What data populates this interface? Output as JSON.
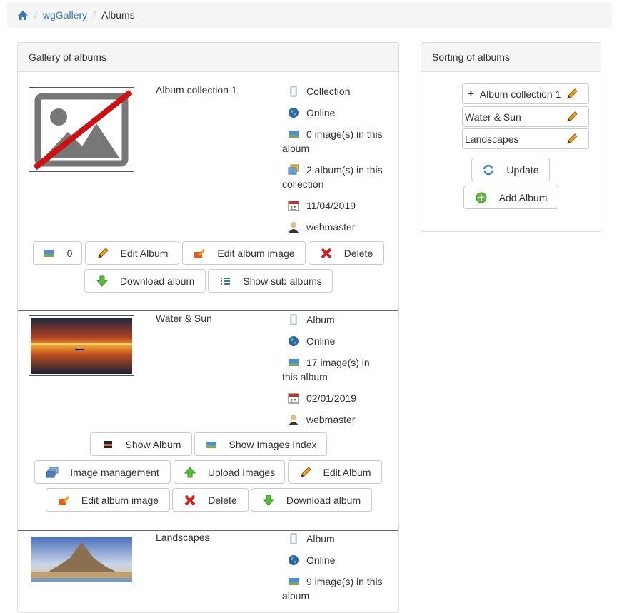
{
  "breadcrumb": {
    "items": [
      "wgGallery",
      "Albums"
    ]
  },
  "gallery_panel": {
    "heading": "Gallery of albums",
    "albums": [
      {
        "name": "Album collection 1",
        "type": "Collection",
        "status": "Online",
        "images_line1": "0 image(s) in this",
        "images_line2": "album",
        "collection_line1": "2 album(s) in this",
        "collection_line2": "collection",
        "date": "11/04/2019",
        "author": "webmaster",
        "buttons": {
          "count": "0",
          "edit_album": "Edit Album",
          "edit_album_image": "Edit album image",
          "delete": "Delete",
          "download_album": "Download album",
          "show_sub_albums": "Show sub albums"
        }
      },
      {
        "name": "Water & Sun",
        "type": "Album",
        "status": "Online",
        "images_line1": "17 image(s) in",
        "images_line2": "this album",
        "date": "02/01/2019",
        "author": "webmaster",
        "buttons": {
          "show_album": "Show Album",
          "show_images_index": "Show Images Index",
          "image_management": "Image management",
          "upload_images": "Upload Images",
          "edit_album": "Edit Album",
          "edit_album_image": "Edit album image",
          "delete": "Delete",
          "download_album": "Download album"
        }
      },
      {
        "name": "Landscapes",
        "type": "Album",
        "status": "Online",
        "images_line1": "9 image(s) in this",
        "images_line2": "album"
      }
    ]
  },
  "sort_panel": {
    "heading": "Sorting of albums",
    "items": [
      "Album collection 1",
      "Water & Sun",
      "Landscapes"
    ],
    "update_button": "Update",
    "add_album_button": "Add Album"
  },
  "colors": {
    "link": "#337ab7",
    "panel_heading_bg": "#f5f5f5",
    "border": "#dddddd"
  },
  "icons": {
    "home": "home-icon",
    "type": "folder-icon",
    "online": "globe-icon",
    "images": "picture-icon",
    "albums": "albums-icon",
    "date": "calendar-icon",
    "author": "user-icon",
    "edit": "pencil-icon",
    "delete": "red-x-icon",
    "download": "green-down-arrow-icon",
    "upload": "green-up-arrow-icon",
    "list": "list-icon",
    "refresh": "refresh-icon",
    "add": "green-plus-icon"
  }
}
